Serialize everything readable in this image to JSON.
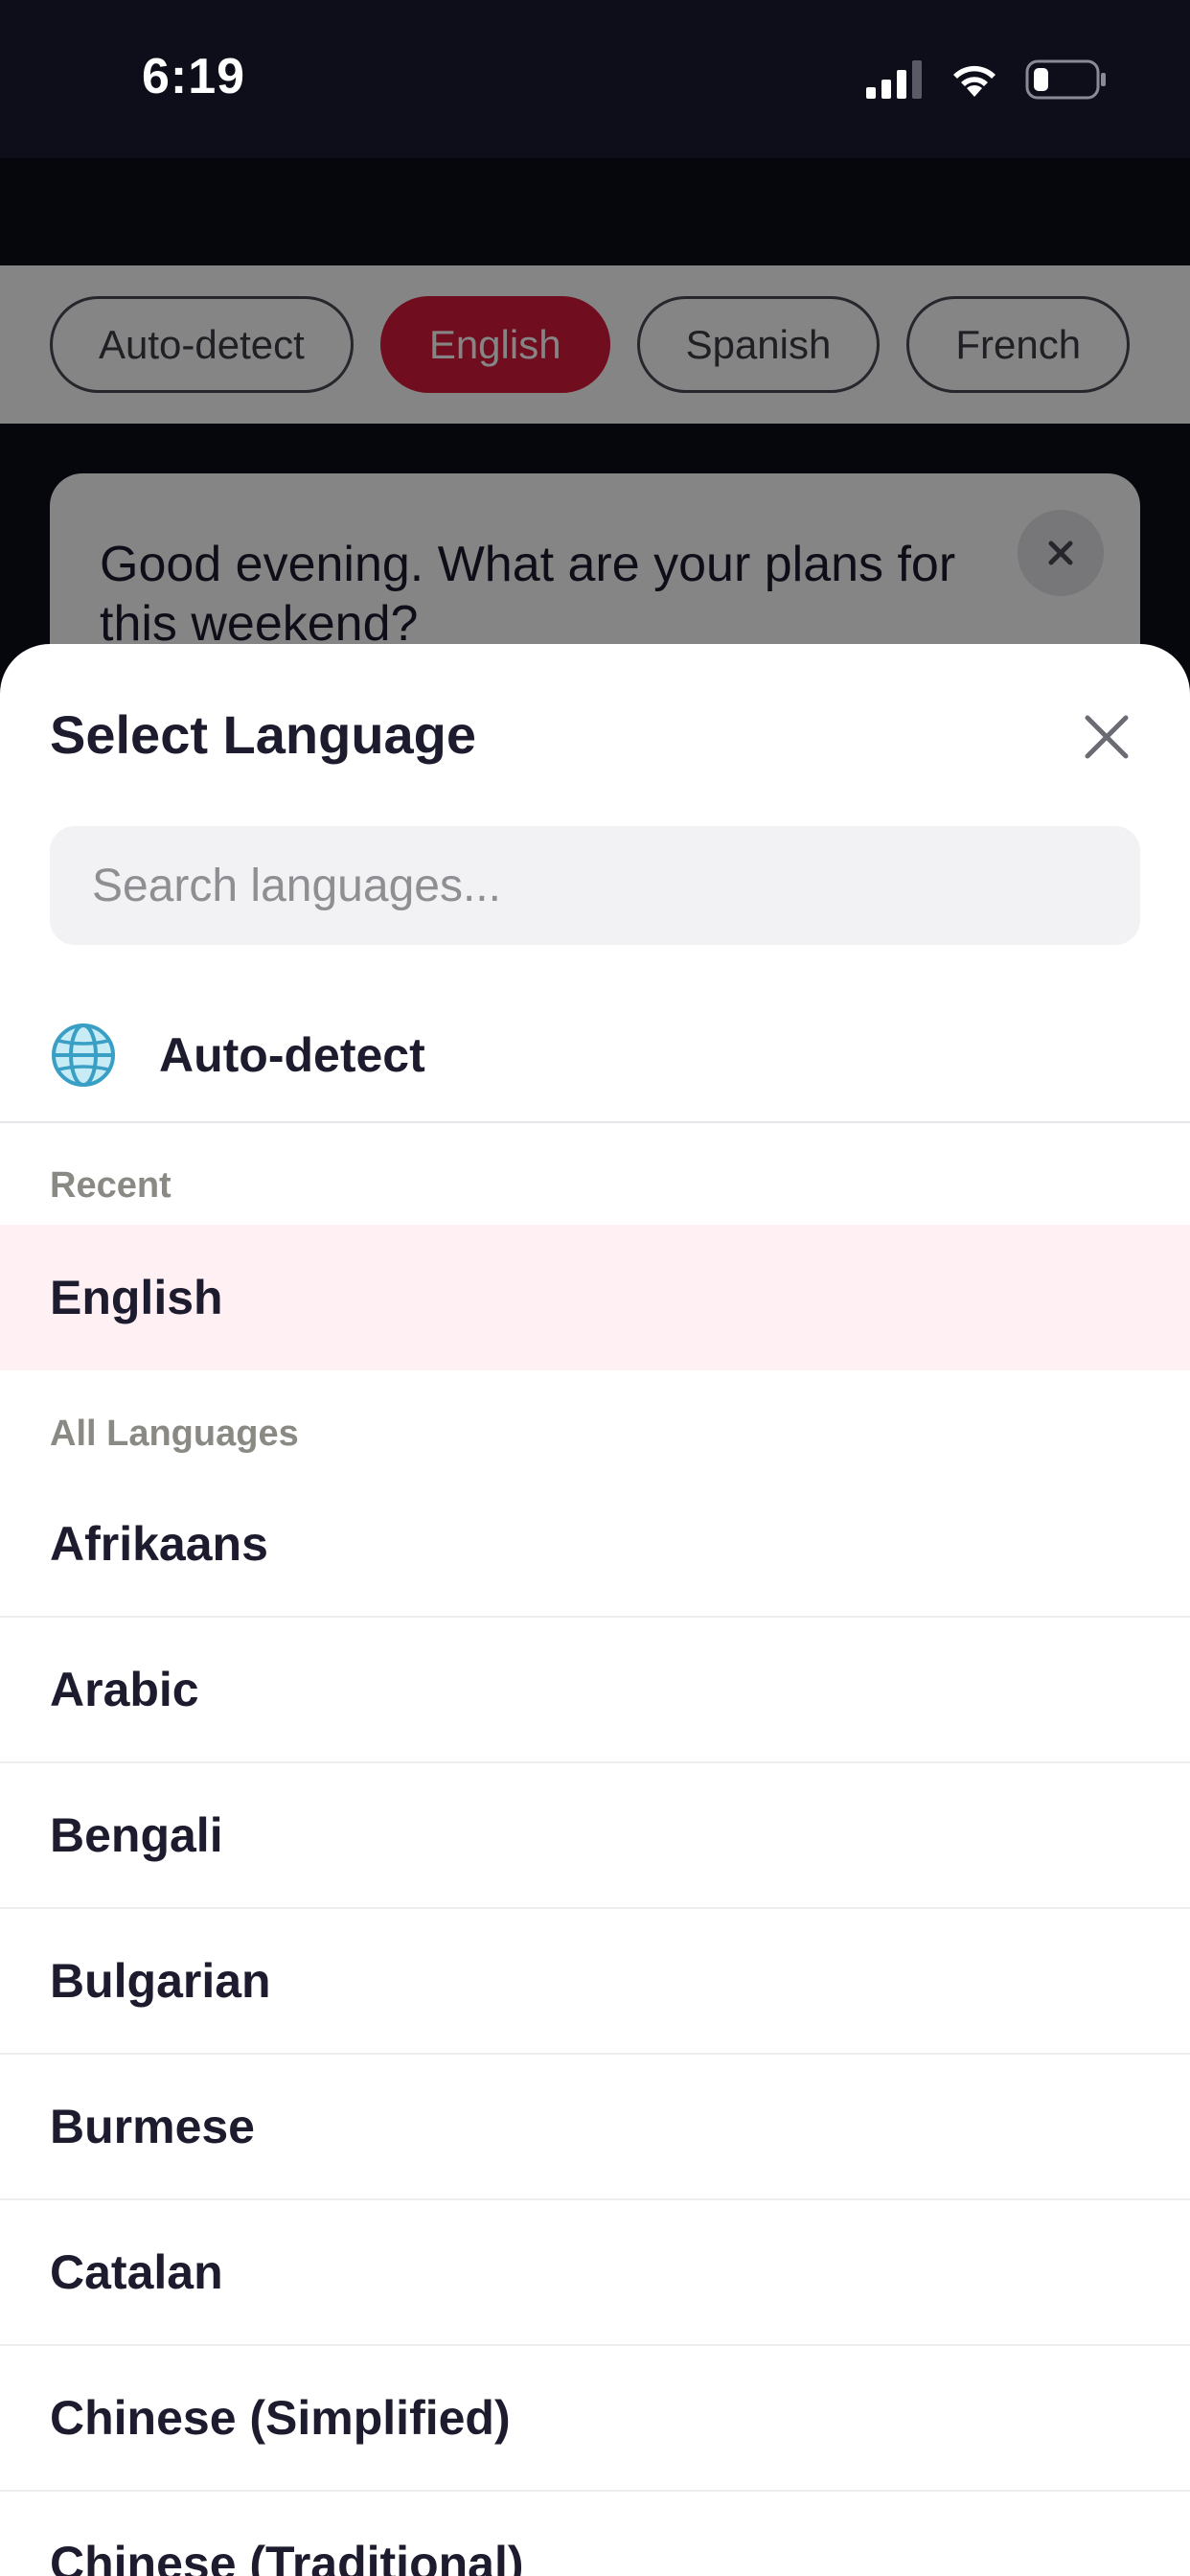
{
  "status_bar": {
    "time": "6:19"
  },
  "background": {
    "chips": [
      "Auto-detect",
      "English",
      "Spanish",
      "French"
    ],
    "active_chip": "English",
    "phrase": "Good evening. What are your plans for this weekend?"
  },
  "sheet": {
    "title": "Select Language",
    "search_placeholder": "Search languages...",
    "auto_detect_label": "Auto-detect",
    "recent_header": "Recent",
    "recent": [
      "English"
    ],
    "all_header": "All Languages",
    "languages": [
      "Afrikaans",
      "Arabic",
      "Bengali",
      "Bulgarian",
      "Burmese",
      "Catalan",
      "Chinese (Simplified)",
      "Chinese (Traditional)"
    ]
  },
  "colors": {
    "accent": "#d6193a",
    "recent_highlight": "#fff0f3",
    "background_dark": "#0d0e1a",
    "text_primary": "#1d1b2e",
    "section_header": "#8a8983"
  },
  "icons": {
    "signal": "cellular-signal-icon",
    "wifi": "wifi-icon",
    "battery": "battery-icon",
    "close": "close-icon",
    "globe": "globe-icon"
  }
}
